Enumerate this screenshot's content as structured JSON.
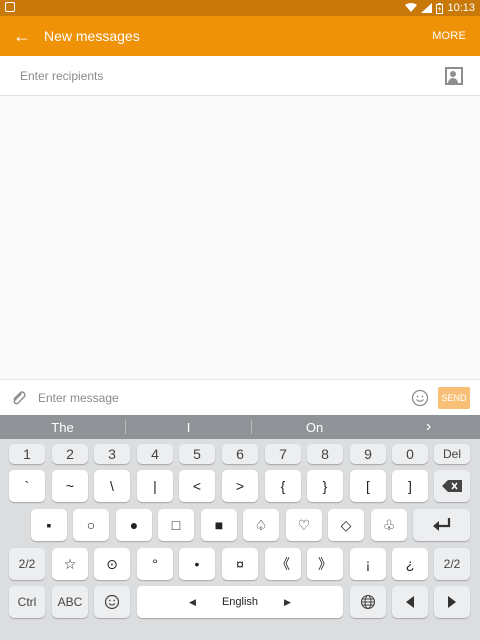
{
  "status": {
    "time": "10:13"
  },
  "appbar": {
    "back_glyph": "←",
    "title": "New messages",
    "more": "MORE"
  },
  "recipients": {
    "placeholder": "Enter recipients"
  },
  "composer": {
    "placeholder": "Enter message",
    "send": "SEND"
  },
  "suggestions": [
    "The",
    "I",
    "On"
  ],
  "keyboard": {
    "row1": [
      "1",
      "2",
      "3",
      "4",
      "5",
      "6",
      "7",
      "8",
      "9",
      "0"
    ],
    "del": "Del",
    "row2": [
      "`",
      "~",
      "\\",
      "|",
      "<",
      ">",
      "{",
      "}",
      "[",
      "]"
    ],
    "row3": [
      "▪",
      "○",
      "●",
      "□",
      "■",
      "♤",
      "♡",
      "◇",
      "♧"
    ],
    "page": "2/2",
    "row4": [
      "☆",
      "⊙",
      "°",
      "•",
      "¤",
      "《",
      "》",
      "¡",
      "¿"
    ],
    "page_right": "2/2",
    "ctrl": "Ctrl",
    "abc": "ABC",
    "space_label": "English"
  },
  "colors": {
    "appbar": "#ef9207",
    "statusbar": "#c8790a",
    "send_disabled": "#f7c076"
  }
}
